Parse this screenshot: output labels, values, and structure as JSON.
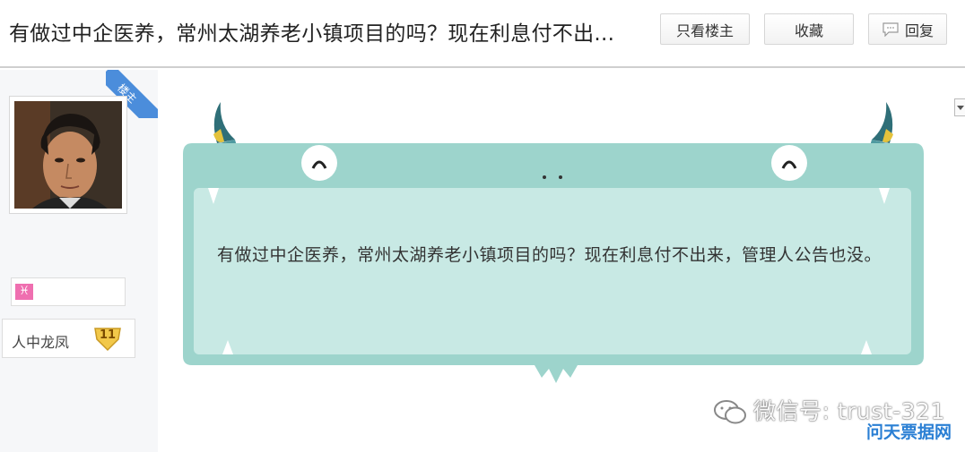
{
  "thread": {
    "title": "有做过中企医养，常州太湖养老小镇项目的吗？现在利息付不出..."
  },
  "toolbar": {
    "only_op_label": "只看楼主",
    "favorite_label": "收藏",
    "reply_label": "回复"
  },
  "author": {
    "badge": "楼主",
    "zodiac_symbol": "♓",
    "rank_title": "人中龙凤",
    "rank_level": "11"
  },
  "post": {
    "content": "有做过中企医养，常州太湖养老小镇项目的吗？现在利息付不出来，管理人公告也没。"
  },
  "watermark": {
    "wechat": "微信号: trust-321",
    "site": "问天票据网"
  },
  "colors": {
    "monster_body": "#9dd4cc",
    "monster_panel": "#c8e9e4",
    "ribbon": "#4b8ddb",
    "zodiac": "#ef6fb0",
    "site_mark": "#2a7fd4"
  }
}
